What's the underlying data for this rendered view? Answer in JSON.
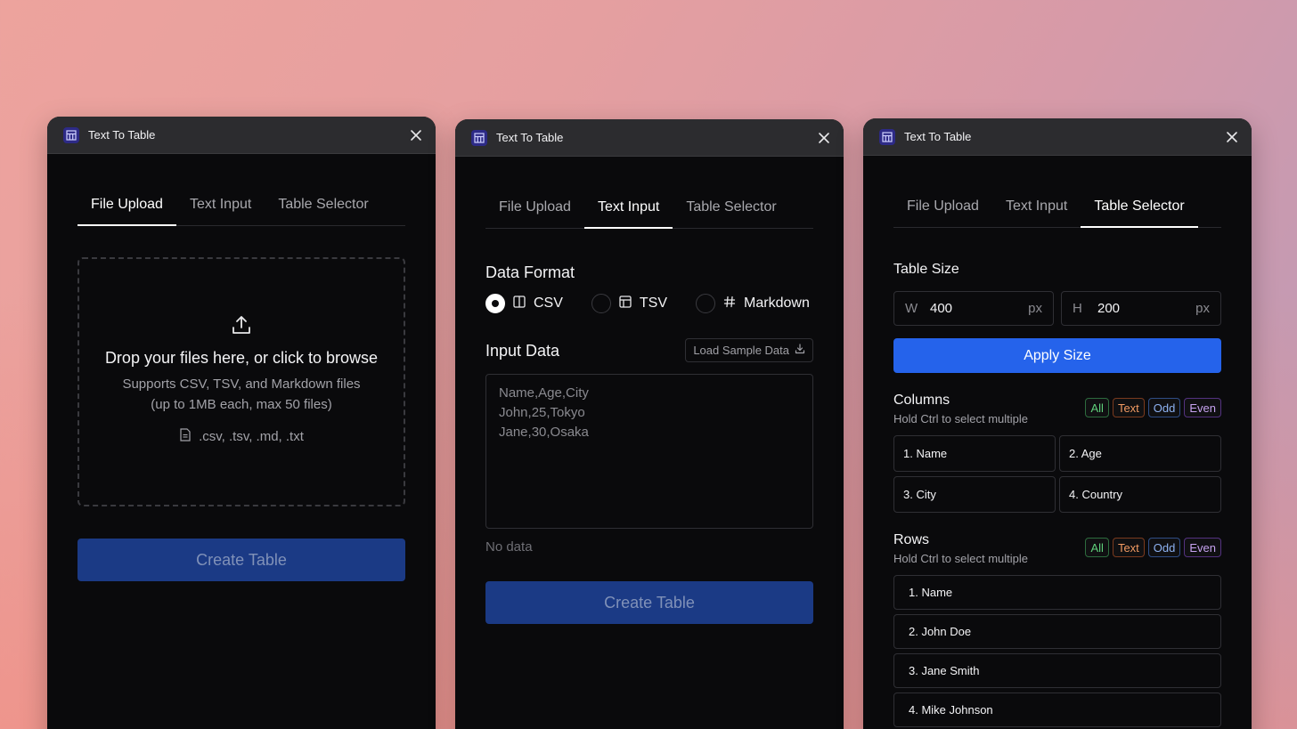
{
  "app": {
    "title": "Text To Table",
    "icon": "table-app-icon"
  },
  "tabs": [
    "File Upload",
    "Text Input",
    "Table Selector"
  ],
  "upload": {
    "drop_title": "Drop your files here, or click to browse",
    "drop_sub_1": "Supports CSV, TSV, and Markdown files",
    "drop_sub_2": "(up to 1MB each, max 50 files)",
    "extensions": ".csv, .tsv, .md, .txt",
    "create_label": "Create Table"
  },
  "text_input": {
    "format_title": "Data Format",
    "formats": [
      {
        "label": "CSV",
        "selected": true
      },
      {
        "label": "TSV",
        "selected": false
      },
      {
        "label": "Markdown",
        "selected": false
      }
    ],
    "input_title": "Input Data",
    "sample_label": "Load Sample Data",
    "placeholder": "Name,Age,City\nJohn,25,Tokyo\nJane,30,Osaka",
    "status": "No data",
    "create_label": "Create Table"
  },
  "selector": {
    "size_title": "Table Size",
    "width": {
      "prefix": "W",
      "value": "400",
      "unit": "px"
    },
    "height": {
      "prefix": "H",
      "value": "200",
      "unit": "px"
    },
    "apply_label": "Apply Size",
    "columns_title": "Columns",
    "columns_hint": "Hold Ctrl to select multiple",
    "columns": [
      "1. Name",
      "2. Age",
      "3. City",
      "4. Country"
    ],
    "rows_title": "Rows",
    "rows_hint": "Hold Ctrl to select multiple",
    "rows": [
      "1. Name",
      "2. John Doe",
      "3. Jane Smith",
      "4. Mike Johnson"
    ],
    "filters": {
      "all": "All",
      "text": "Text",
      "odd": "Odd",
      "even": "Even"
    }
  },
  "colors": {
    "accent": "#2563eb",
    "disabled_button": "#1b3a85",
    "panel_bg": "#0a0a0c",
    "titlebar_bg": "#2c2c2f"
  }
}
